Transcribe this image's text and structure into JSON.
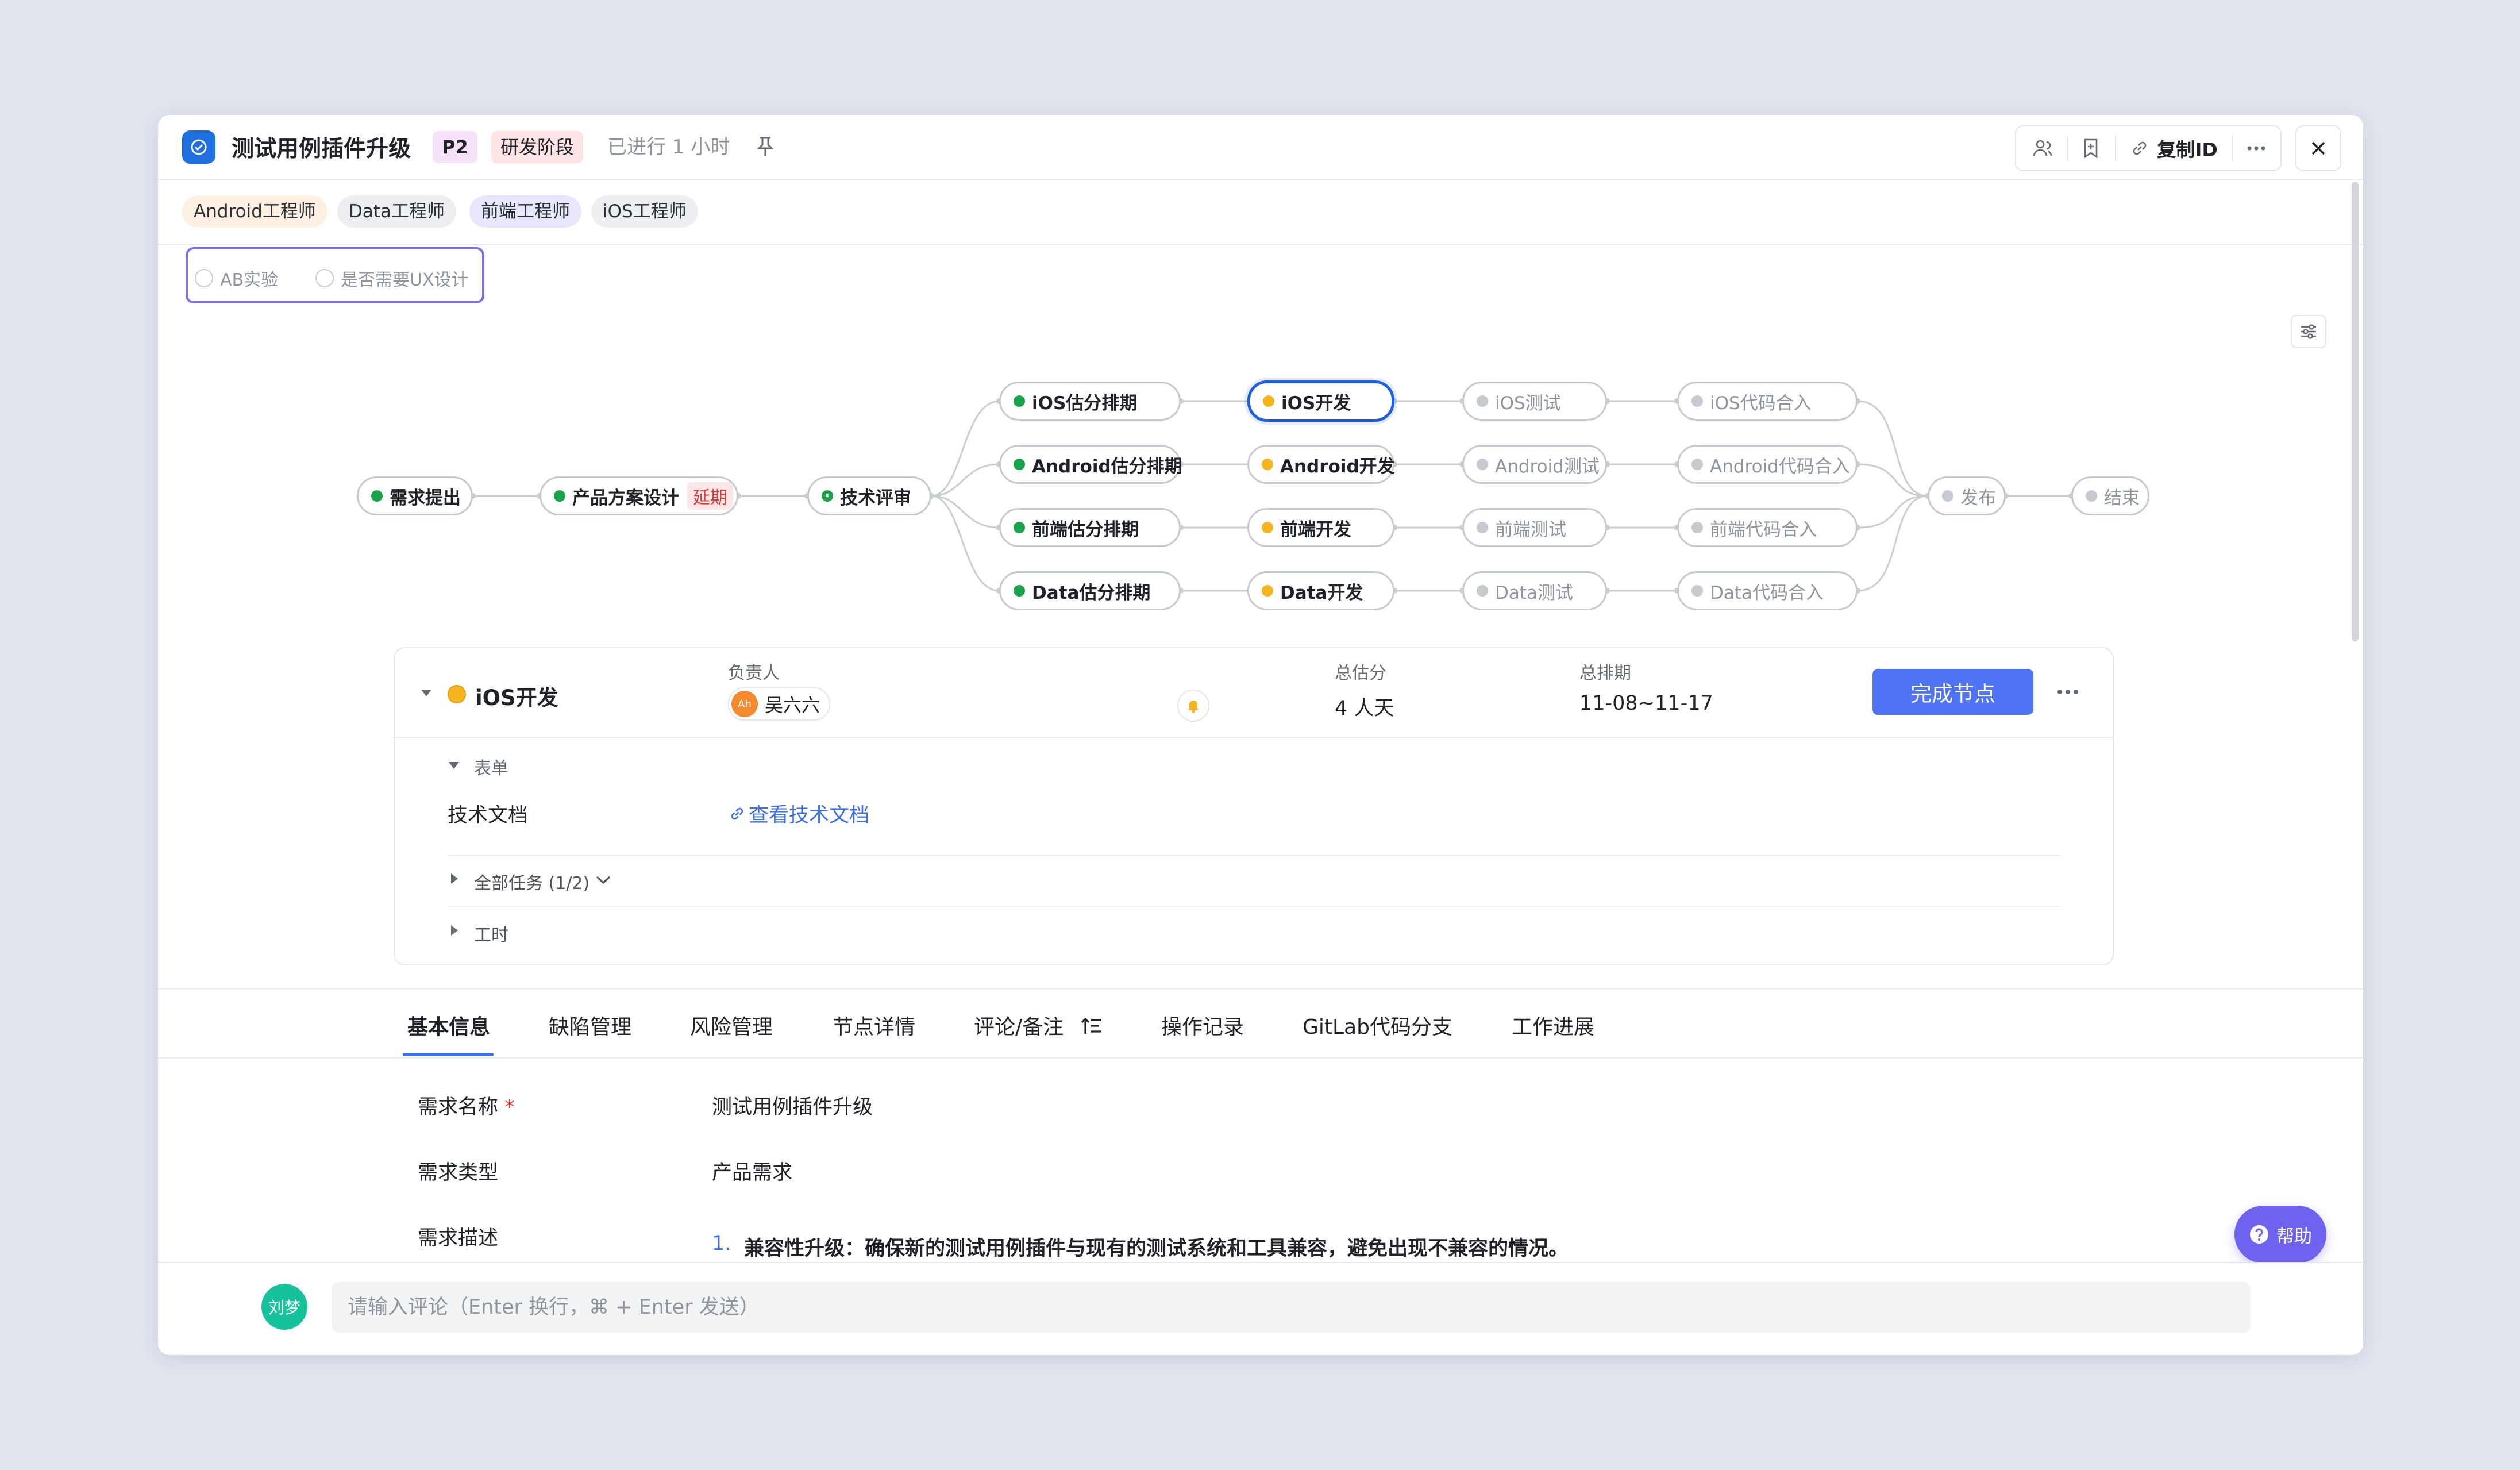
{
  "header": {
    "title": "测试用例插件升级",
    "priority": "P2",
    "stage": "研发阶段",
    "elapsed": "已进行 1 小时",
    "copy_id": "复制ID"
  },
  "roles": [
    "Android工程师",
    "Data工程师",
    "前端工程师",
    "iOS工程师"
  ],
  "checks": [
    "AB实验",
    "是否需要UX设计"
  ],
  "flow": {
    "start": "需求提出",
    "design": "产品方案设计",
    "design_delay": "延期",
    "review": "技术评审",
    "est": [
      "iOS估分排期",
      "Android估分排期",
      "前端估分排期",
      "Data估分排期"
    ],
    "dev": [
      "iOS开发",
      "Android开发",
      "前端开发",
      "Data开发"
    ],
    "test": [
      "iOS测试",
      "Android测试",
      "前端测试",
      "Data测试"
    ],
    "merge": [
      "iOS代码合入",
      "Android代码合入",
      "前端代码合入",
      "Data代码合入"
    ],
    "release": "发布",
    "end": "结束"
  },
  "node_detail": {
    "name": "iOS开发",
    "owner_label": "负责人",
    "owner": "吴六六",
    "owner_avatar": "Ah",
    "points_label": "总估分",
    "points": "4 人天",
    "schedule_label": "总排期",
    "schedule": "11-08~11-17",
    "complete_button": "完成节点",
    "form_label": "表单",
    "doc_label": "技术文档",
    "doc_link": "查看技术文档",
    "tasks": "全部任务 (1/2)",
    "worktime": "工时"
  },
  "tabs": [
    "基本信息",
    "缺陷管理",
    "风险管理",
    "节点详情",
    "评论/备注",
    "操作记录",
    "GitLab代码分支",
    "工作进展"
  ],
  "basic": {
    "name_label": "需求名称",
    "required_mark": "*",
    "name_value": "测试用例插件升级",
    "type_label": "需求类型",
    "type_value": "产品需求",
    "desc_label": "需求描述",
    "desc_index": "1.",
    "desc_value": "兼容性升级：确保新的测试用例插件与现有的测试系统和工具兼容，避免出现不兼容的情况。"
  },
  "comment": {
    "avatar": "刘梦",
    "placeholder": "请输入评论（Enter 换行，⌘ + Enter 发送）"
  },
  "help": "帮助",
  "colors": {
    "green": "#1aa34a",
    "yellow": "#f5b51f",
    "gray": "#c5c9d0",
    "accent": "#4f74f5"
  }
}
